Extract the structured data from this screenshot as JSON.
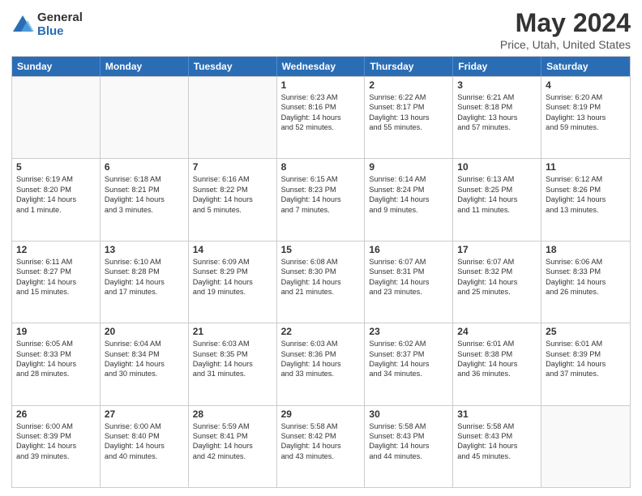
{
  "logo": {
    "general": "General",
    "blue": "Blue"
  },
  "title": "May 2024",
  "subtitle": "Price, Utah, United States",
  "header_days": [
    "Sunday",
    "Monday",
    "Tuesday",
    "Wednesday",
    "Thursday",
    "Friday",
    "Saturday"
  ],
  "weeks": [
    [
      {
        "day": "",
        "info": ""
      },
      {
        "day": "",
        "info": ""
      },
      {
        "day": "",
        "info": ""
      },
      {
        "day": "1",
        "info": "Sunrise: 6:23 AM\nSunset: 8:16 PM\nDaylight: 14 hours\nand 52 minutes."
      },
      {
        "day": "2",
        "info": "Sunrise: 6:22 AM\nSunset: 8:17 PM\nDaylight: 13 hours\nand 55 minutes."
      },
      {
        "day": "3",
        "info": "Sunrise: 6:21 AM\nSunset: 8:18 PM\nDaylight: 13 hours\nand 57 minutes."
      },
      {
        "day": "4",
        "info": "Sunrise: 6:20 AM\nSunset: 8:19 PM\nDaylight: 13 hours\nand 59 minutes."
      }
    ],
    [
      {
        "day": "5",
        "info": "Sunrise: 6:19 AM\nSunset: 8:20 PM\nDaylight: 14 hours\nand 1 minute."
      },
      {
        "day": "6",
        "info": "Sunrise: 6:18 AM\nSunset: 8:21 PM\nDaylight: 14 hours\nand 3 minutes."
      },
      {
        "day": "7",
        "info": "Sunrise: 6:16 AM\nSunset: 8:22 PM\nDaylight: 14 hours\nand 5 minutes."
      },
      {
        "day": "8",
        "info": "Sunrise: 6:15 AM\nSunset: 8:23 PM\nDaylight: 14 hours\nand 7 minutes."
      },
      {
        "day": "9",
        "info": "Sunrise: 6:14 AM\nSunset: 8:24 PM\nDaylight: 14 hours\nand 9 minutes."
      },
      {
        "day": "10",
        "info": "Sunrise: 6:13 AM\nSunset: 8:25 PM\nDaylight: 14 hours\nand 11 minutes."
      },
      {
        "day": "11",
        "info": "Sunrise: 6:12 AM\nSunset: 8:26 PM\nDaylight: 14 hours\nand 13 minutes."
      }
    ],
    [
      {
        "day": "12",
        "info": "Sunrise: 6:11 AM\nSunset: 8:27 PM\nDaylight: 14 hours\nand 15 minutes."
      },
      {
        "day": "13",
        "info": "Sunrise: 6:10 AM\nSunset: 8:28 PM\nDaylight: 14 hours\nand 17 minutes."
      },
      {
        "day": "14",
        "info": "Sunrise: 6:09 AM\nSunset: 8:29 PM\nDaylight: 14 hours\nand 19 minutes."
      },
      {
        "day": "15",
        "info": "Sunrise: 6:08 AM\nSunset: 8:30 PM\nDaylight: 14 hours\nand 21 minutes."
      },
      {
        "day": "16",
        "info": "Sunrise: 6:07 AM\nSunset: 8:31 PM\nDaylight: 14 hours\nand 23 minutes."
      },
      {
        "day": "17",
        "info": "Sunrise: 6:07 AM\nSunset: 8:32 PM\nDaylight: 14 hours\nand 25 minutes."
      },
      {
        "day": "18",
        "info": "Sunrise: 6:06 AM\nSunset: 8:33 PM\nDaylight: 14 hours\nand 26 minutes."
      }
    ],
    [
      {
        "day": "19",
        "info": "Sunrise: 6:05 AM\nSunset: 8:33 PM\nDaylight: 14 hours\nand 28 minutes."
      },
      {
        "day": "20",
        "info": "Sunrise: 6:04 AM\nSunset: 8:34 PM\nDaylight: 14 hours\nand 30 minutes."
      },
      {
        "day": "21",
        "info": "Sunrise: 6:03 AM\nSunset: 8:35 PM\nDaylight: 14 hours\nand 31 minutes."
      },
      {
        "day": "22",
        "info": "Sunrise: 6:03 AM\nSunset: 8:36 PM\nDaylight: 14 hours\nand 33 minutes."
      },
      {
        "day": "23",
        "info": "Sunrise: 6:02 AM\nSunset: 8:37 PM\nDaylight: 14 hours\nand 34 minutes."
      },
      {
        "day": "24",
        "info": "Sunrise: 6:01 AM\nSunset: 8:38 PM\nDaylight: 14 hours\nand 36 minutes."
      },
      {
        "day": "25",
        "info": "Sunrise: 6:01 AM\nSunset: 8:39 PM\nDaylight: 14 hours\nand 37 minutes."
      }
    ],
    [
      {
        "day": "26",
        "info": "Sunrise: 6:00 AM\nSunset: 8:39 PM\nDaylight: 14 hours\nand 39 minutes."
      },
      {
        "day": "27",
        "info": "Sunrise: 6:00 AM\nSunset: 8:40 PM\nDaylight: 14 hours\nand 40 minutes."
      },
      {
        "day": "28",
        "info": "Sunrise: 5:59 AM\nSunset: 8:41 PM\nDaylight: 14 hours\nand 42 minutes."
      },
      {
        "day": "29",
        "info": "Sunrise: 5:58 AM\nSunset: 8:42 PM\nDaylight: 14 hours\nand 43 minutes."
      },
      {
        "day": "30",
        "info": "Sunrise: 5:58 AM\nSunset: 8:43 PM\nDaylight: 14 hours\nand 44 minutes."
      },
      {
        "day": "31",
        "info": "Sunrise: 5:58 AM\nSunset: 8:43 PM\nDaylight: 14 hours\nand 45 minutes."
      },
      {
        "day": "",
        "info": ""
      }
    ]
  ]
}
